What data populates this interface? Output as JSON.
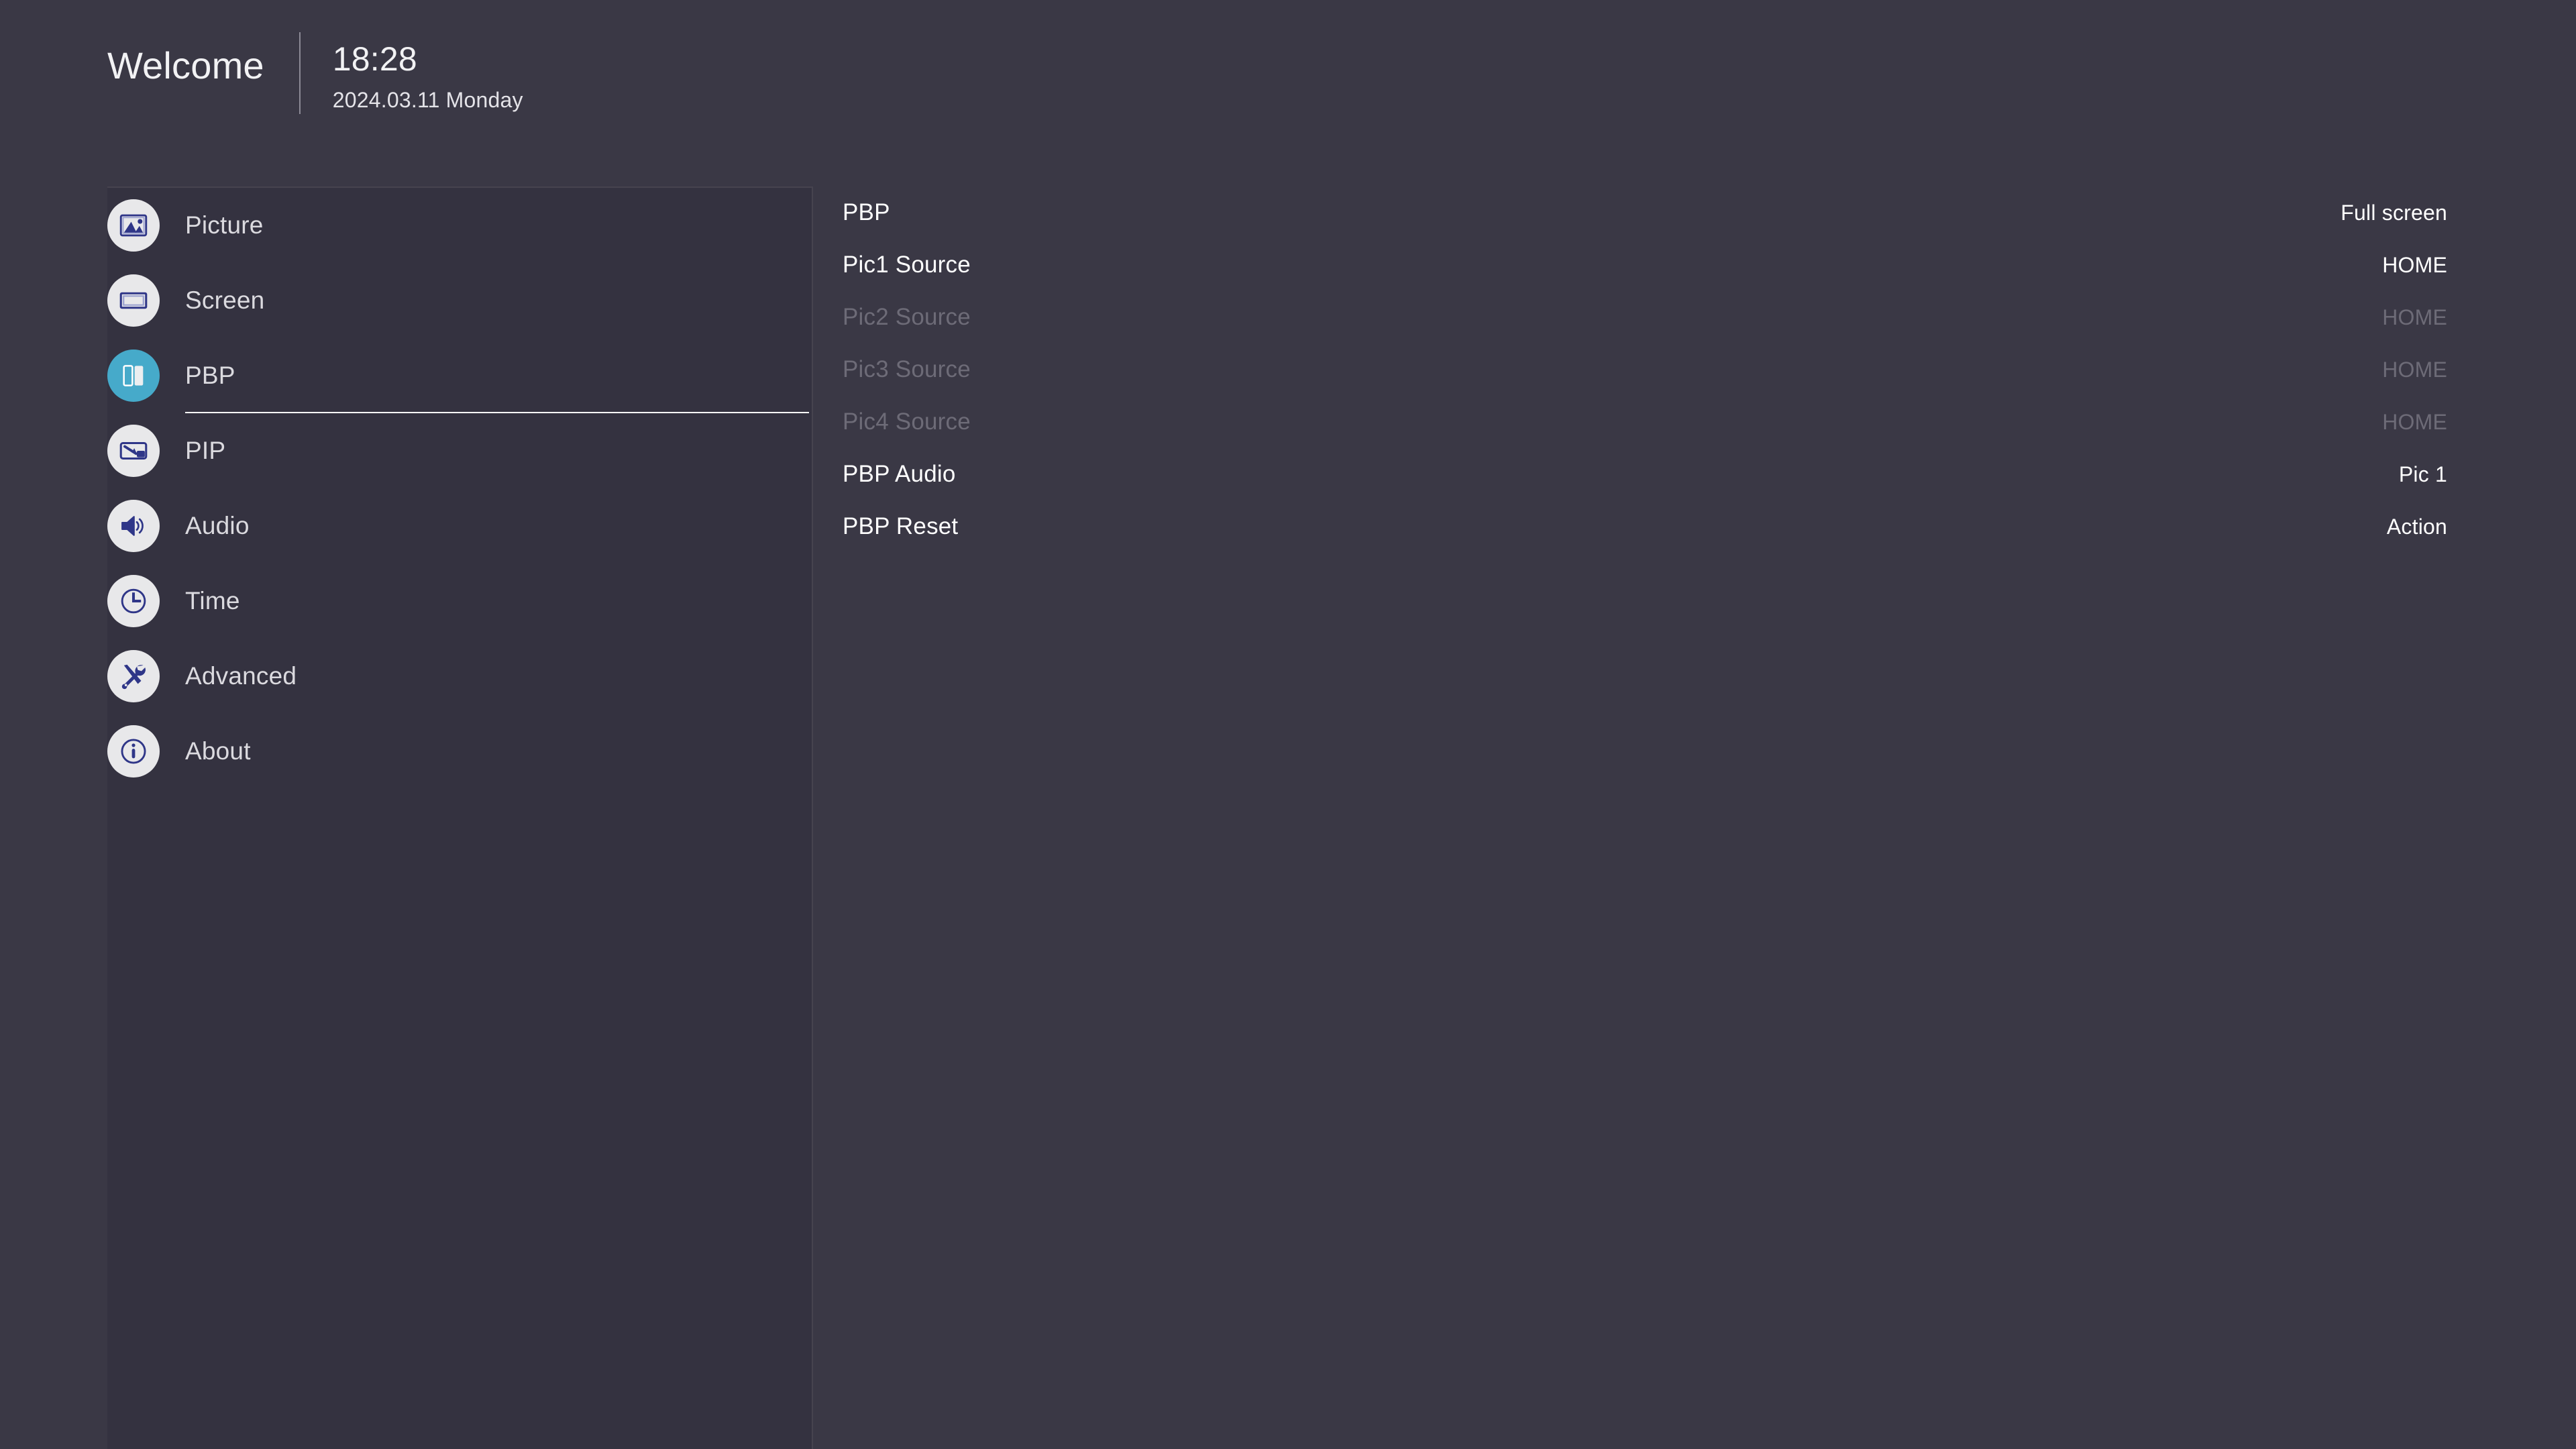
{
  "header": {
    "welcome": "Welcome",
    "time": "18:28",
    "date": "2024.03.11 Monday"
  },
  "colors": {
    "background": "#3a3845",
    "sidebar_background": "#343240",
    "accent": "#46aaca",
    "icon": "#2f3688",
    "icon_circle": "#e8e8ea",
    "text_primary": "#ffffff",
    "text_secondary": "#dbdadf",
    "text_disabled": "#6d6b77"
  },
  "sidebar": {
    "items": [
      {
        "label": "Picture",
        "icon": "picture-icon",
        "active": false
      },
      {
        "label": "Screen",
        "icon": "screen-icon",
        "active": false
      },
      {
        "label": "PBP",
        "icon": "pbp-icon",
        "active": true
      },
      {
        "label": "PIP",
        "icon": "pip-icon",
        "active": false
      },
      {
        "label": "Audio",
        "icon": "audio-icon",
        "active": false
      },
      {
        "label": "Time",
        "icon": "clock-icon",
        "active": false
      },
      {
        "label": "Advanced",
        "icon": "tools-icon",
        "active": false
      },
      {
        "label": "About",
        "icon": "info-icon",
        "active": false
      }
    ]
  },
  "content": {
    "rows": [
      {
        "label": "PBP",
        "value": "Full screen",
        "disabled": false
      },
      {
        "label": "Pic1 Source",
        "value": "HOME",
        "disabled": false
      },
      {
        "label": "Pic2 Source",
        "value": "HOME",
        "disabled": true
      },
      {
        "label": "Pic3 Source",
        "value": "HOME",
        "disabled": true
      },
      {
        "label": "Pic4 Source",
        "value": "HOME",
        "disabled": true
      },
      {
        "label": "PBP Audio",
        "value": "Pic 1",
        "disabled": false
      },
      {
        "label": "PBP Reset",
        "value": "Action",
        "disabled": false
      }
    ]
  }
}
